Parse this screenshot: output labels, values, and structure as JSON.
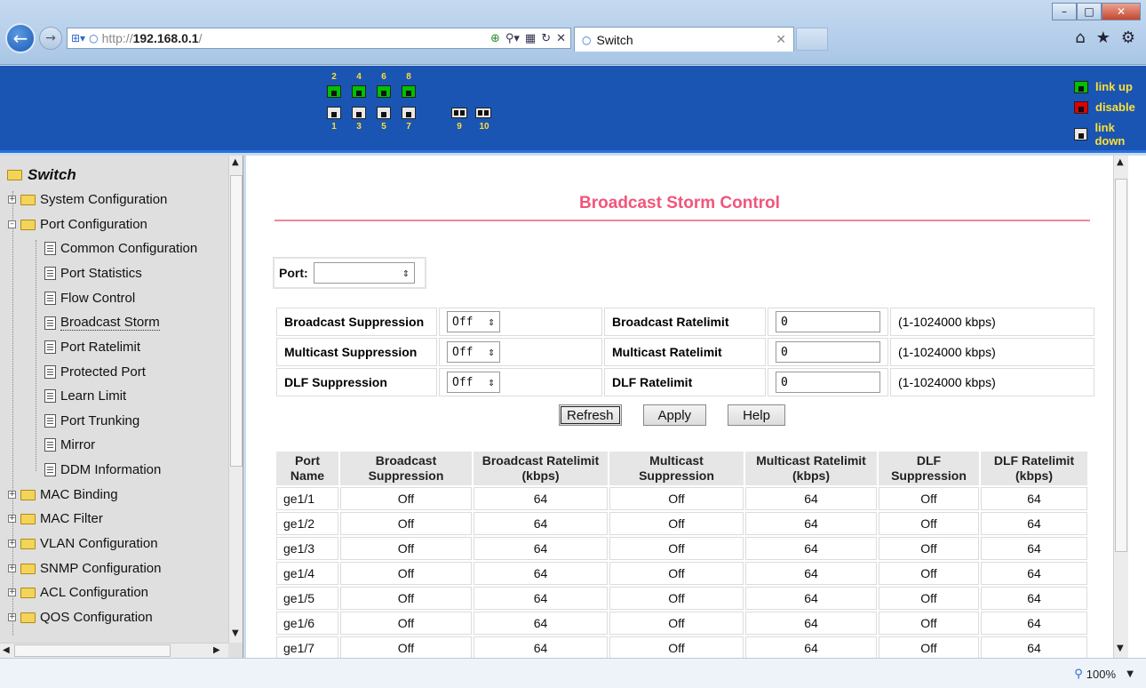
{
  "browser": {
    "url_prefix": "http://",
    "url_host": "192.168.0.1",
    "url_suffix": "/",
    "tab_title": "Switch",
    "window_controls": [
      "minimize-icon",
      "maximize-icon",
      "close-icon"
    ],
    "toolbar_icons": [
      "home-icon",
      "star-icon",
      "gear-icon"
    ]
  },
  "ports": {
    "top_labels": [
      "2",
      "4",
      "6",
      "8"
    ],
    "bottom_labels": [
      "1",
      "3",
      "5",
      "7",
      "9",
      "10"
    ],
    "legend": [
      {
        "label": "link up",
        "state": "up",
        "color": "#00c000"
      },
      {
        "label": "disable",
        "state": "disable",
        "color": "#e00000"
      },
      {
        "label": "link down",
        "state": "down",
        "color": "#e8e8e8"
      }
    ],
    "states": {
      "2": "up",
      "4": "up",
      "6": "up",
      "8": "up",
      "1": "down",
      "3": "down",
      "5": "down",
      "7": "down",
      "9": "down",
      "10": "down"
    }
  },
  "nav": {
    "root": "Switch",
    "items": [
      {
        "label": "System Configuration",
        "type": "folder"
      },
      {
        "label": "Port Configuration",
        "type": "folder-open"
      },
      {
        "label": "Common Configuration",
        "type": "page"
      },
      {
        "label": "Port Statistics",
        "type": "page"
      },
      {
        "label": "Flow Control",
        "type": "page"
      },
      {
        "label": "Broadcast Storm",
        "type": "page",
        "selected": true
      },
      {
        "label": "Port Ratelimit",
        "type": "page"
      },
      {
        "label": "Protected Port",
        "type": "page"
      },
      {
        "label": "Learn Limit",
        "type": "page"
      },
      {
        "label": "Port Trunking",
        "type": "page"
      },
      {
        "label": "Mirror",
        "type": "page"
      },
      {
        "label": "DDM Information",
        "type": "page"
      },
      {
        "label": "MAC Binding",
        "type": "folder"
      },
      {
        "label": "MAC Filter",
        "type": "folder"
      },
      {
        "label": "VLAN Configuration",
        "type": "folder"
      },
      {
        "label": "SNMP Configuration",
        "type": "folder"
      },
      {
        "label": "ACL Configuration",
        "type": "folder"
      },
      {
        "label": "QOS Configuration",
        "type": "folder"
      }
    ]
  },
  "main": {
    "title": "Broadcast Storm Control",
    "port_label": "Port:",
    "port_value": "",
    "config": [
      {
        "suppression_label": "Broadcast Suppression",
        "suppression_value": "Off",
        "ratelimit_label": "Broadcast Ratelimit",
        "ratelimit_value": "0",
        "range": "(1-1024000 kbps)"
      },
      {
        "suppression_label": "Multicast Suppression",
        "suppression_value": "Off",
        "ratelimit_label": "Multicast Ratelimit",
        "ratelimit_value": "0",
        "range": "(1-1024000 kbps)"
      },
      {
        "suppression_label": "DLF Suppression",
        "suppression_value": "Off",
        "ratelimit_label": "DLF Ratelimit",
        "ratelimit_value": "0",
        "range": "(1-1024000 kbps)"
      }
    ],
    "buttons": {
      "refresh": "Refresh",
      "apply": "Apply",
      "help": "Help"
    },
    "table": {
      "headers": [
        [
          "Port",
          "Name"
        ],
        [
          "Broadcast",
          "Suppression"
        ],
        [
          "Broadcast Ratelimit",
          "(kbps)"
        ],
        [
          "Multicast",
          "Suppression"
        ],
        [
          "Multicast Ratelimit",
          "(kbps)"
        ],
        [
          "DLF",
          "Suppression"
        ],
        [
          "DLF Ratelimit",
          "(kbps)"
        ]
      ],
      "rows": [
        [
          "ge1/1",
          "Off",
          "64",
          "Off",
          "64",
          "Off",
          "64"
        ],
        [
          "ge1/2",
          "Off",
          "64",
          "Off",
          "64",
          "Off",
          "64"
        ],
        [
          "ge1/3",
          "Off",
          "64",
          "Off",
          "64",
          "Off",
          "64"
        ],
        [
          "ge1/4",
          "Off",
          "64",
          "Off",
          "64",
          "Off",
          "64"
        ],
        [
          "ge1/5",
          "Off",
          "64",
          "Off",
          "64",
          "Off",
          "64"
        ],
        [
          "ge1/6",
          "Off",
          "64",
          "Off",
          "64",
          "Off",
          "64"
        ],
        [
          "ge1/7",
          "Off",
          "64",
          "Off",
          "64",
          "Off",
          "64"
        ]
      ]
    }
  },
  "status": {
    "zoom": "100%"
  }
}
